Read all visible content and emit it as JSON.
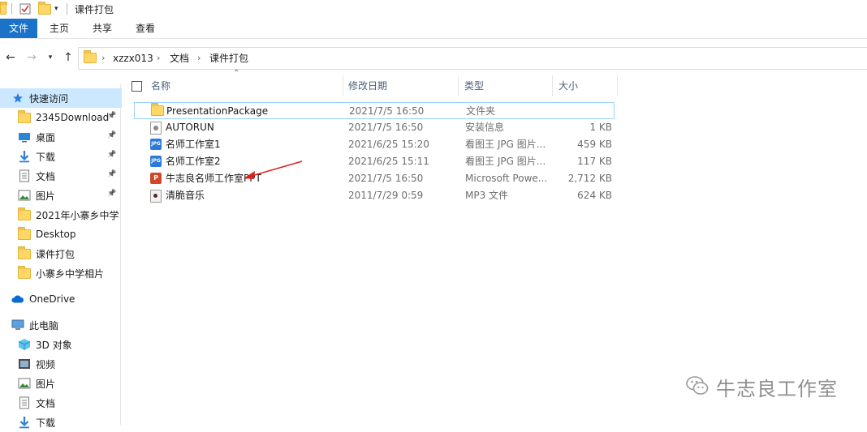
{
  "window": {
    "title": "课件打包"
  },
  "ribbon": {
    "tabs": [
      "文件",
      "主页",
      "共享",
      "查看"
    ]
  },
  "address": {
    "crumbs": [
      "xzzx013",
      "文档",
      "课件打包"
    ]
  },
  "sidebar": {
    "items": [
      {
        "label": "快速访问",
        "icon": "star-icon",
        "pinned": false,
        "active": true
      },
      {
        "label": "2345Download",
        "icon": "folder-icon",
        "pinned": true
      },
      {
        "label": "桌面",
        "icon": "desktop-icon",
        "pinned": true
      },
      {
        "label": "下载",
        "icon": "download-icon",
        "pinned": true
      },
      {
        "label": "文档",
        "icon": "documents-icon",
        "pinned": true
      },
      {
        "label": "图片",
        "icon": "pictures-icon",
        "pinned": true
      },
      {
        "label": "2021年小寨乡中学",
        "icon": "folder-icon",
        "pinned": false
      },
      {
        "label": "Desktop",
        "icon": "folder-icon",
        "pinned": false
      },
      {
        "label": "课件打包",
        "icon": "folder-icon",
        "pinned": false
      },
      {
        "label": "小寨乡中学相片",
        "icon": "folder-icon",
        "pinned": false
      },
      {
        "label": "OneDrive",
        "icon": "cloud-icon",
        "pinned": false
      },
      {
        "label": "此电脑",
        "icon": "computer-icon",
        "pinned": false
      },
      {
        "label": "3D 对象",
        "icon": "3d-objects-icon",
        "pinned": false
      },
      {
        "label": "视频",
        "icon": "videos-icon",
        "pinned": false
      },
      {
        "label": "图片",
        "icon": "pictures-icon",
        "pinned": false
      },
      {
        "label": "文档",
        "icon": "documents-icon",
        "pinned": false
      },
      {
        "label": "下载",
        "icon": "download-icon",
        "pinned": false
      }
    ]
  },
  "columns": {
    "name": "名称",
    "date": "修改日期",
    "type": "类型",
    "size": "大小"
  },
  "files": [
    {
      "name": "PresentationPackage",
      "date": "2021/7/5 16:50",
      "type": "文件夹",
      "size": "",
      "icon": "folder-icon",
      "selected": true
    },
    {
      "name": "AUTORUN",
      "date": "2021/7/5 16:50",
      "type": "安装信息",
      "size": "1 KB",
      "icon": "setup-info-icon"
    },
    {
      "name": "名师工作室1",
      "date": "2021/6/25 15:20",
      "type": "看图王 JPG 图片...",
      "size": "459 KB",
      "icon": "jpg-icon"
    },
    {
      "name": "名师工作室2",
      "date": "2021/6/25 15:11",
      "type": "看图王 JPG 图片...",
      "size": "117 KB",
      "icon": "jpg-icon"
    },
    {
      "name": "牛志良名师工作室PPT",
      "date": "2021/7/5 16:50",
      "type": "Microsoft Powe...",
      "size": "2,712 KB",
      "icon": "powerpoint-icon"
    },
    {
      "name": "清脆音乐",
      "date": "2011/7/29 0:59",
      "type": "MP3 文件",
      "size": "624 KB",
      "icon": "mp3-icon"
    }
  ],
  "watermark": {
    "text": "牛志良工作室"
  },
  "colors": {
    "accent": "#1a73c9",
    "selection": "#cce8ff",
    "annotation_arrow": "#e02020"
  }
}
